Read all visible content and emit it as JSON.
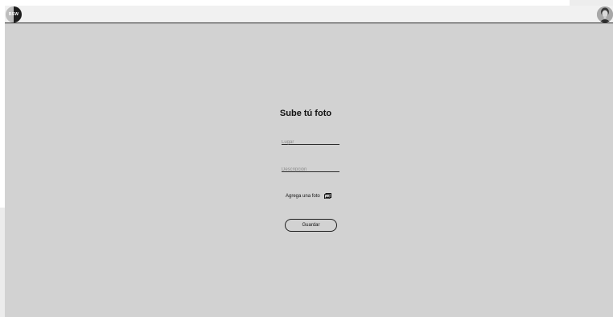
{
  "header": {
    "logo_text": "BSW",
    "logo_icon": "logo-icon",
    "avatar_icon": "user-avatar-icon"
  },
  "form": {
    "title": "Sube tú foto",
    "lugar_placeholder": "Lugar",
    "lugar_value": "",
    "descripcion_placeholder": "Descripción",
    "descripcion_value": "",
    "add_photo_label": "Agrega una foto",
    "add_photo_icon": "image-icon",
    "save_label": "Guardar"
  },
  "colors": {
    "background": "#d2d2d2",
    "header": "#f1f1f1",
    "text": "#111111"
  }
}
